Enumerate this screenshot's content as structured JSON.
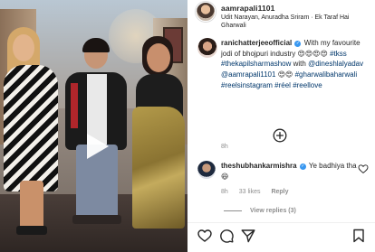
{
  "post": {
    "author": "aamrapali1101",
    "audio": "Udit Narayan, Anuradha Sriram · Ek Taraf Hai Gharwali"
  },
  "caption": {
    "username": "ranichatterjeeofficial",
    "text_1": "With my favourite jodi of bhojpuri industry 😍😍😍😍",
    "tags_1": [
      "#tkss",
      "#thekapilsharmashow"
    ],
    "with": "with",
    "mentions": [
      "@dineshlalyadav",
      "@aamrapali1101"
    ],
    "emoji_2": "😍😍",
    "tags_2": [
      "#gharwalibaharwali",
      "#reelsinstagram",
      "#réel",
      "#reellove"
    ],
    "time": "8h"
  },
  "comment": {
    "username": "theshubhankarmishra",
    "text": "Ye badhiya tha 😆",
    "time": "8h",
    "likes": "33 likes",
    "reply": "Reply"
  },
  "view_replies": "View replies (3)",
  "icons": {
    "play": "play-icon",
    "more": "plus-circle-icon",
    "like": "heart-icon",
    "comment": "comment-icon",
    "share": "send-icon",
    "save": "bookmark-icon"
  },
  "colors": {
    "text": "#262626",
    "muted": "#8e8e8e",
    "link": "#00376b",
    "verified": "#3897f0"
  }
}
